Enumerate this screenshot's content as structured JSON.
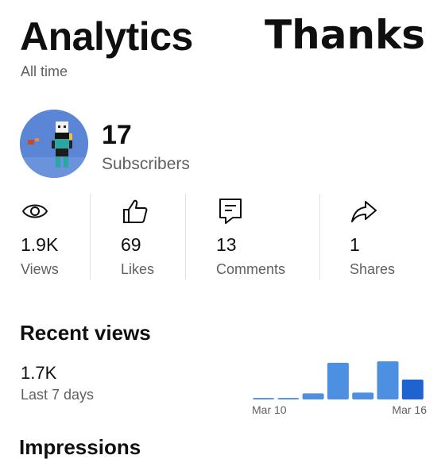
{
  "header": {
    "title": "Analytics",
    "overlay_text": "Thanks",
    "period": "All time"
  },
  "channel": {
    "subscriber_count": "17",
    "subscriber_label": "Subscribers"
  },
  "stats": [
    {
      "icon": "eye-icon",
      "value": "1.9K",
      "label": "Views"
    },
    {
      "icon": "thumbs-up-icon",
      "value": "69",
      "label": "Likes"
    },
    {
      "icon": "comment-icon",
      "value": "13",
      "label": "Comments"
    },
    {
      "icon": "share-icon",
      "value": "1",
      "label": "Shares"
    }
  ],
  "recent_views": {
    "title": "Recent views",
    "value": "1.7K",
    "period_label": "Last 7 days"
  },
  "chart_data": {
    "type": "bar",
    "title": "",
    "xlabel": "",
    "ylabel": "",
    "tick_labels": [
      "Mar 10",
      "Mar 16"
    ],
    "categories": [
      "Mar 10",
      "Mar 11",
      "Mar 12",
      "Mar 13",
      "Mar 14",
      "Mar 15",
      "Mar 16"
    ],
    "values": [
      2,
      2,
      8,
      48,
      9,
      50,
      26
    ],
    "colors": {
      "normal": "#4d8fe0",
      "highlight": "#1e63d0"
    },
    "highlight_index": 6
  },
  "next_section_partial": "Impressions"
}
